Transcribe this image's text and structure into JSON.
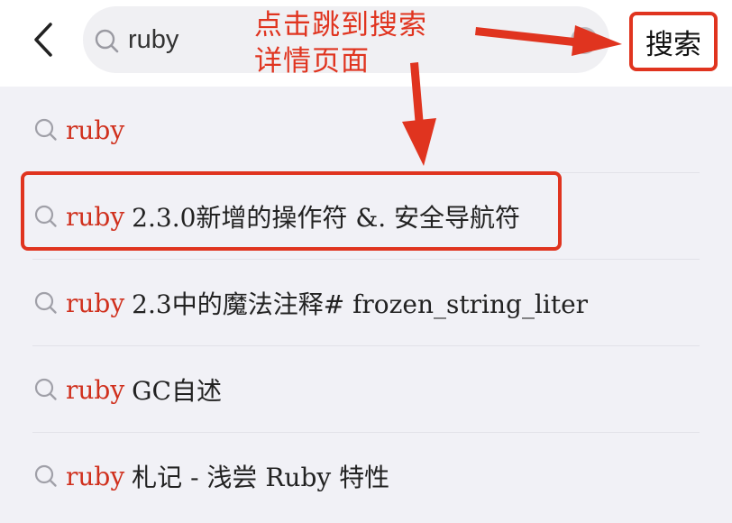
{
  "header": {
    "query": "ruby",
    "search_button_label": "搜索"
  },
  "annotation": {
    "line1": "点击跳到搜索",
    "line2": "详情页面",
    "color": "#e0341f"
  },
  "suggestions": {
    "keyword": "ruby",
    "items": [
      {
        "keyword": "ruby",
        "rest": ""
      },
      {
        "keyword": "ruby",
        "rest": "2.3.0新增的操作符 &. 安全导航符"
      },
      {
        "keyword": "ruby",
        "rest": "2.3中的魔法注释# frozen_string_liter"
      },
      {
        "keyword": "ruby",
        "rest": "GC自述"
      },
      {
        "keyword": "ruby",
        "rest": "札记 - 浅尝 Ruby 特性"
      }
    ]
  },
  "colors": {
    "keyword_highlight": "#d0301d",
    "background": "#f1f1f6"
  },
  "icons": {
    "back": "chevron-left-icon",
    "search": "search-icon",
    "clear": "clear-icon"
  }
}
